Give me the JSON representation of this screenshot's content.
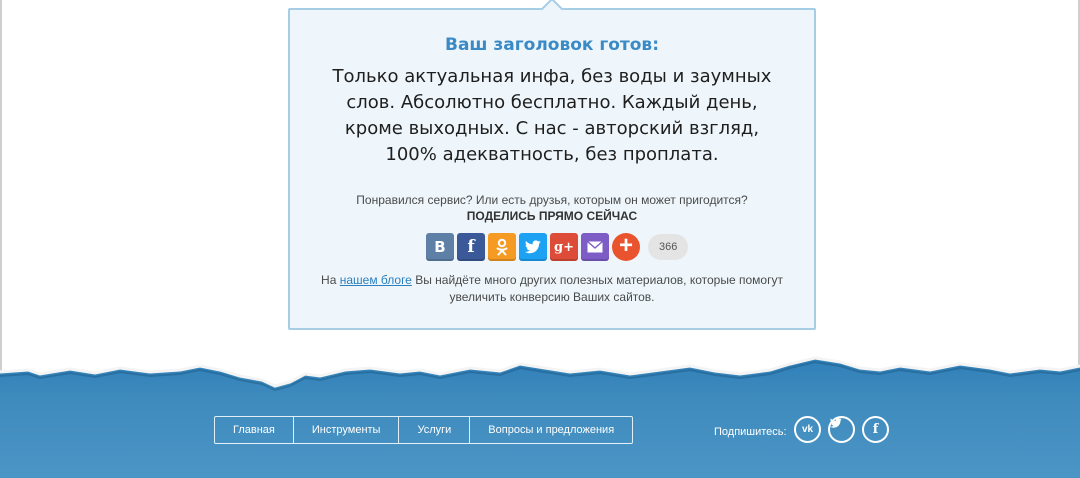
{
  "result": {
    "title": "Ваш заголовок готов:",
    "text": "Только актуальная инфа, без воды и заумных слов. Абсолютно бесплатно. Каждый день, кроме выходных. С нас - авторский взгляд, 100% адекватность, без проплата."
  },
  "share": {
    "question": "Понравился сервис? Или есть друзья, которым он может пригодится?",
    "cta": "ПОДЕЛИСЬ ПРЯМО СЕЙЧАС",
    "buttons": [
      {
        "name": "vk",
        "glyph": "B",
        "icon": "vk-icon",
        "color": "#5e80a7"
      },
      {
        "name": "facebook",
        "glyph": "f",
        "icon": "facebook-icon",
        "color": "#3b5998"
      },
      {
        "name": "odnoklassniki",
        "glyph": "ok",
        "icon": "odnoklassniki-icon",
        "color": "#f59a22"
      },
      {
        "name": "twitter",
        "glyph": "tw",
        "icon": "twitter-icon",
        "color": "#1da1f2"
      },
      {
        "name": "google-plus",
        "glyph": "g+",
        "icon": "google-plus-icon",
        "color": "#dd4b39"
      },
      {
        "name": "mail",
        "glyph": "mail",
        "icon": "mail-icon",
        "color": "#7d5cc6"
      },
      {
        "name": "more",
        "glyph": "+",
        "icon": "plus-icon",
        "color": "#e9542f"
      }
    ],
    "count": "366"
  },
  "blog": {
    "prefix": "На ",
    "link": "нашем блоге",
    "suffix": " Вы найдёте много других полезных материалов, которые помогут увеличить конверсию Ваших сайтов."
  },
  "footer": {
    "nav": [
      "Главная",
      "Инструменты",
      "Услуги",
      "Вопросы и предложения"
    ],
    "subscribe_label": "Подпишитесь:",
    "social": [
      "vk-icon",
      "twitter-icon",
      "facebook-icon"
    ],
    "bg_color": "#3f8bbd"
  }
}
